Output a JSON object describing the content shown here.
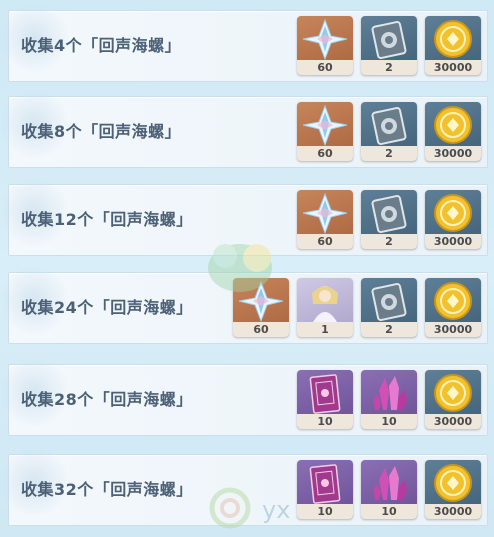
{
  "rows": [
    {
      "title": "收集4个「回声海螺」",
      "rewards": [
        {
          "icon": "primogem-icon",
          "count": "60"
        },
        {
          "icon": "hero-wit-book-icon",
          "count": "2"
        },
        {
          "icon": "mora-coin-icon",
          "count": "30000"
        }
      ]
    },
    {
      "title": "收集8个「回声海螺」",
      "rewards": [
        {
          "icon": "primogem-icon",
          "count": "60"
        },
        {
          "icon": "hero-wit-book-icon",
          "count": "2"
        },
        {
          "icon": "mora-coin-icon",
          "count": "30000"
        }
      ]
    },
    {
      "title": "收集12个「回声海螺」",
      "rewards": [
        {
          "icon": "primogem-icon",
          "count": "60"
        },
        {
          "icon": "hero-wit-book-icon",
          "count": "2"
        },
        {
          "icon": "mora-coin-icon",
          "count": "30000"
        }
      ]
    },
    {
      "title": "收集24个「回声海螺」",
      "rewards": [
        {
          "icon": "primogem-icon",
          "count": "60"
        },
        {
          "icon": "character-card-icon",
          "count": "1"
        },
        {
          "icon": "hero-wit-book-icon",
          "count": "2"
        },
        {
          "icon": "mora-coin-icon",
          "count": "30000"
        }
      ]
    },
    {
      "title": "收集28个「回声海螺」",
      "rewards": [
        {
          "icon": "purple-book-icon",
          "count": "10"
        },
        {
          "icon": "purple-crystal-icon",
          "count": "10"
        },
        {
          "icon": "mora-coin-icon",
          "count": "30000"
        }
      ]
    },
    {
      "title": "收集32个「回声海螺」",
      "rewards": [
        {
          "icon": "purple-book-icon",
          "count": "10"
        },
        {
          "icon": "purple-crystal-icon",
          "count": "10"
        },
        {
          "icon": "mora-coin-icon",
          "count": "30000"
        }
      ]
    }
  ],
  "watermark": {
    "text": "yx"
  }
}
